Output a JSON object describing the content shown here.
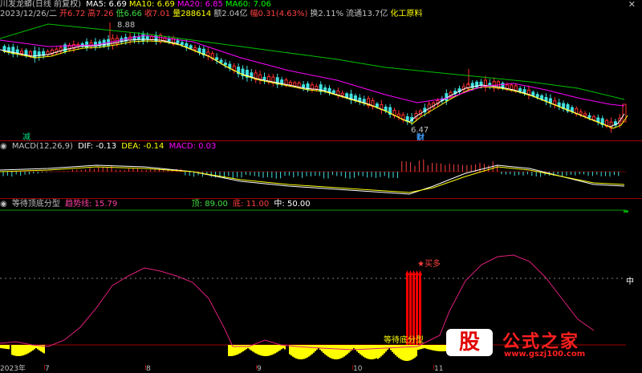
{
  "main": {
    "title": "川发龙蟒(日线 前复权)",
    "ma": [
      {
        "label": "MA5: 6.69",
        "color": "#ffffff"
      },
      {
        "label": "MA10: 6.69",
        "color": "#ffff00"
      },
      {
        "label": "MA20: 6.85",
        "color": "#ff00ff"
      },
      {
        "label": "MA60: 7.06",
        "color": "#00ff00"
      }
    ],
    "close_icon": "close-icon",
    "bar_info": [
      {
        "label": "2023/12/26/二",
        "color": "#c0c0c0"
      },
      {
        "label": "开6.72",
        "color": "#ff4040"
      },
      {
        "label": "高7.26",
        "color": "#ff4040"
      },
      {
        "label": "低6.66",
        "color": "#40e040"
      },
      {
        "label": "收7.01",
        "color": "#ff4040"
      },
      {
        "label": "量288614",
        "color": "#ffff00"
      },
      {
        "label": "额2.04亿",
        "color": "#c0c0c0"
      },
      {
        "label": "幅0.31(4.63%)",
        "color": "#ff4040"
      },
      {
        "label": "换2.11%",
        "color": "#c0c0c0"
      },
      {
        "label": "流通13.7亿",
        "color": "#c0c0c0"
      },
      {
        "label": "化工原料",
        "color": "#ffff00"
      }
    ],
    "high_marker": "8.88",
    "low_marker": "6.47",
    "cai_marker": "财",
    "jian_marker": "减"
  },
  "macd": {
    "name": "MACD(12,26,9)",
    "dif": "DIF: -0.13",
    "dea": "DEA: -0.14",
    "macd": "MACD: 0.03"
  },
  "indicator": {
    "name": "等待顶底分型",
    "trend": "趋势线: 15.79",
    "top": "顶: 89.00",
    "bottom": "底: 11.00",
    "mid": "中: 50.00",
    "signal_label": "等待底分型",
    "buy_label": "买多",
    "mid_tag": "中"
  },
  "xaxis": {
    "labels": [
      "2023年",
      "7",
      "8",
      "9",
      "10",
      "11"
    ]
  },
  "watermark": {
    "gu": "股",
    "text": "公式之家",
    "url": "www.gszj100.com"
  }
}
